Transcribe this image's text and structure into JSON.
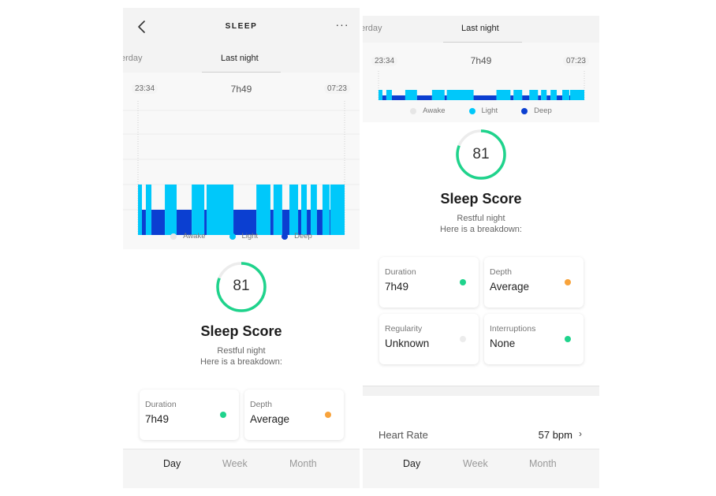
{
  "header": {
    "title": "SLEEP",
    "back_icon": "chevron-left-icon",
    "more_icon": "more-horizontal-icon",
    "more_glyph": "···"
  },
  "date_tabs": {
    "previous_label": "erday",
    "active_label": "Last night"
  },
  "chart": {
    "start_time": "23:34",
    "end_time": "07:23",
    "duration": "7h49",
    "legend": [
      {
        "label": "Awake",
        "color": "#e6e6e6"
      },
      {
        "label": "Light",
        "color": "#00c8fa"
      },
      {
        "label": "Deep",
        "color": "#0b3fd1"
      }
    ]
  },
  "chart_data": {
    "type": "hypnogram",
    "title": "",
    "x_start": "23:34",
    "x_end": "07:23",
    "total_minutes": 469,
    "stages": [
      "Awake",
      "Light",
      "Deep"
    ],
    "segments": [
      {
        "stage": "Light",
        "start_frac": 0.0,
        "end_frac": 0.019
      },
      {
        "stage": "Deep",
        "start_frac": 0.019,
        "end_frac": 0.038
      },
      {
        "stage": "Light",
        "start_frac": 0.038,
        "end_frac": 0.065
      },
      {
        "stage": "Deep",
        "start_frac": 0.065,
        "end_frac": 0.13
      },
      {
        "stage": "Light",
        "start_frac": 0.13,
        "end_frac": 0.187
      },
      {
        "stage": "Deep",
        "start_frac": 0.187,
        "end_frac": 0.26
      },
      {
        "stage": "Light",
        "start_frac": 0.26,
        "end_frac": 0.321
      },
      {
        "stage": "Deep",
        "start_frac": 0.321,
        "end_frac": 0.332
      },
      {
        "stage": "Light",
        "start_frac": 0.332,
        "end_frac": 0.462
      },
      {
        "stage": "Deep",
        "start_frac": 0.462,
        "end_frac": 0.573
      },
      {
        "stage": "Light",
        "start_frac": 0.573,
        "end_frac": 0.641
      },
      {
        "stage": "Deep",
        "start_frac": 0.641,
        "end_frac": 0.656
      },
      {
        "stage": "Light",
        "start_frac": 0.656,
        "end_frac": 0.698
      },
      {
        "stage": "Deep",
        "start_frac": 0.698,
        "end_frac": 0.733
      },
      {
        "stage": "Light",
        "start_frac": 0.733,
        "end_frac": 0.775
      },
      {
        "stage": "Deep",
        "start_frac": 0.775,
        "end_frac": 0.79
      },
      {
        "stage": "Light",
        "start_frac": 0.79,
        "end_frac": 0.817
      },
      {
        "stage": "Deep",
        "start_frac": 0.817,
        "end_frac": 0.836
      },
      {
        "stage": "Light",
        "start_frac": 0.836,
        "end_frac": 0.866
      },
      {
        "stage": "Deep",
        "start_frac": 0.866,
        "end_frac": 0.893
      },
      {
        "stage": "Light",
        "start_frac": 0.893,
        "end_frac": 0.927
      },
      {
        "stage": "Deep",
        "start_frac": 0.927,
        "end_frac": 0.931
      },
      {
        "stage": "Light",
        "start_frac": 0.931,
        "end_frac": 1.0
      }
    ],
    "colors": {
      "Awake": "#e6e6e6",
      "Light": "#00c8fa",
      "Deep": "#0b3fd1"
    },
    "legend_position": "bottom",
    "grid": true
  },
  "score": {
    "value": "81",
    "percent": 81,
    "ring_color": "#1fd38c",
    "ring_track_color": "#ececec",
    "title": "Sleep Score",
    "subtitle_line1": "Restful night",
    "subtitle_line2": "Here is a breakdown:"
  },
  "metrics": [
    {
      "label": "Duration",
      "value": "7h49",
      "status_color": "#1fd38c"
    },
    {
      "label": "Depth",
      "value": "Average",
      "status_color": "#f8a33b"
    },
    {
      "label": "Regularity",
      "value": "Unknown",
      "status_color": "#ececec"
    },
    {
      "label": "Interruptions",
      "value": "None",
      "status_color": "#1fd38c"
    }
  ],
  "heart_rate": {
    "label": "Heart Rate",
    "value": "57 bpm",
    "chevron": "›"
  },
  "bottom_nav": {
    "day": "Day",
    "week": "Week",
    "month": "Month",
    "active": "Day"
  }
}
